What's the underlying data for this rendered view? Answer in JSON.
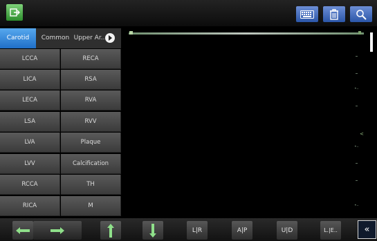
{
  "tabs": [
    {
      "label": "Carotid",
      "active": true
    },
    {
      "label": "Common",
      "active": false
    },
    {
      "label": "Upper Ar..",
      "active": false
    }
  ],
  "cells": [
    [
      "LCCA",
      "RECA"
    ],
    [
      "LICA",
      "RSA"
    ],
    [
      "LECA",
      "RVA"
    ],
    [
      "LSA",
      "RVV"
    ],
    [
      "LVA",
      "Plaque"
    ],
    [
      "LVV",
      "Calcification"
    ],
    [
      "RCCA",
      "TH"
    ],
    [
      "RICA",
      "M"
    ]
  ],
  "bottom_buttons": {
    "lr": "L|R",
    "ap": "A|P",
    "ud": "U|D",
    "le": "L.|E..",
    "collapse": "«"
  },
  "icons": {
    "exit": "exit-icon",
    "keyboard": "keyboard-icon",
    "trash": "trash-icon",
    "search": "search-icon",
    "left": "arrow-left-icon",
    "right": "arrow-right-icon",
    "up": "arrow-up-icon",
    "down": "arrow-down-icon"
  },
  "colors": {
    "accent_green": "#2c8d2c",
    "accent_blue": "#2b56a8",
    "tab_active": "#1f6fc8"
  }
}
